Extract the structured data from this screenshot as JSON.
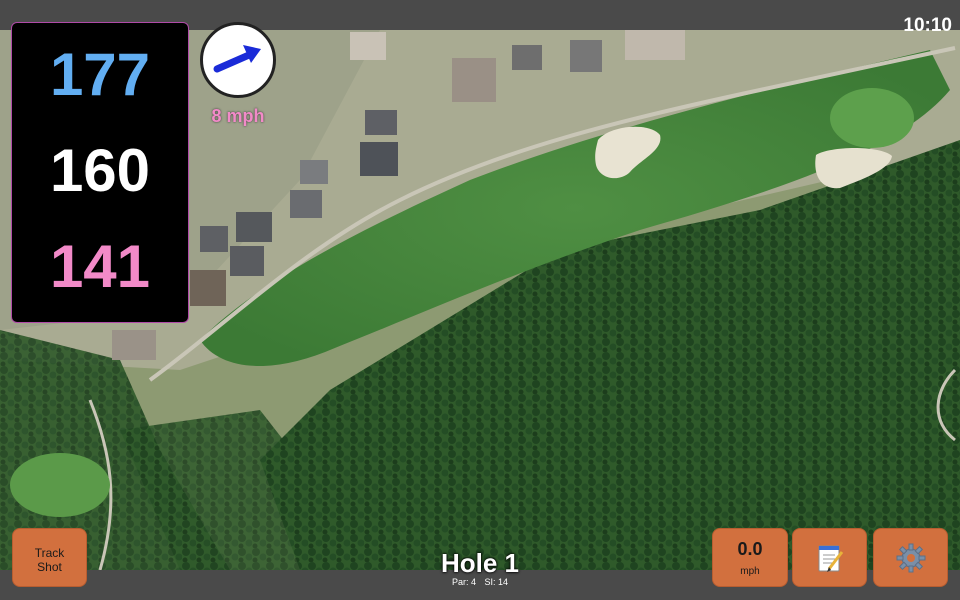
{
  "status": {
    "time": "10:10"
  },
  "distances": {
    "back": "177",
    "middle": "160",
    "front": "141"
  },
  "wind": {
    "speed": "8 mph",
    "direction_icon": "arrow-right-icon"
  },
  "hole": {
    "title": "Hole 1",
    "par": "Par: 4",
    "stroke_index": "SI: 14"
  },
  "buttons": {
    "track_shot_line1": "Track",
    "track_shot_line2": "Shot",
    "speed_value": "0.0",
    "speed_unit": "mph",
    "notes_icon": "notepad-icon",
    "settings_icon": "gear-icon"
  },
  "colors": {
    "back_distance": "#62aef2",
    "middle_distance": "#ffffff",
    "front_distance": "#f28ac8",
    "button_orange": "#d2703e",
    "wind_arrow": "#1a2bd8"
  }
}
